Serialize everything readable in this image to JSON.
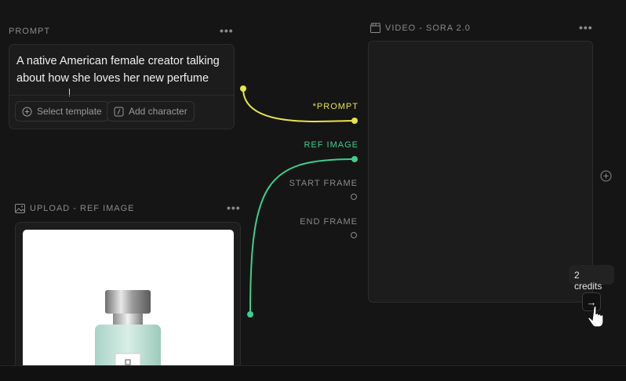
{
  "prompt_node": {
    "title": "PROMPT",
    "text": "A native American female creator talking about how she loves her new perfume",
    "select_template_label": "Select template",
    "add_character_label": "Add character"
  },
  "upload_node": {
    "title": "UPLOAD - REF IMAGE"
  },
  "video_node": {
    "title": "VIDEO - SORA 2.0",
    "ports": {
      "prompt": "*PROMPT",
      "ref_image": "REF IMAGE",
      "start_frame": "START FRAME",
      "end_frame": "END FRAME"
    },
    "credits_tooltip": "2 credits"
  },
  "colors": {
    "prompt_wire": "#e7e34a",
    "ref_wire": "#3ecf8e",
    "background": "#151515"
  },
  "icons": {
    "menu": "more-horizontal-icon",
    "plus": "plus-circle-icon",
    "template": "plus-circle-icon",
    "character": "character-icon",
    "video": "clapperboard-icon",
    "image": "image-icon",
    "run": "arrow-right-icon",
    "cursor": "hand-pointer-icon"
  }
}
